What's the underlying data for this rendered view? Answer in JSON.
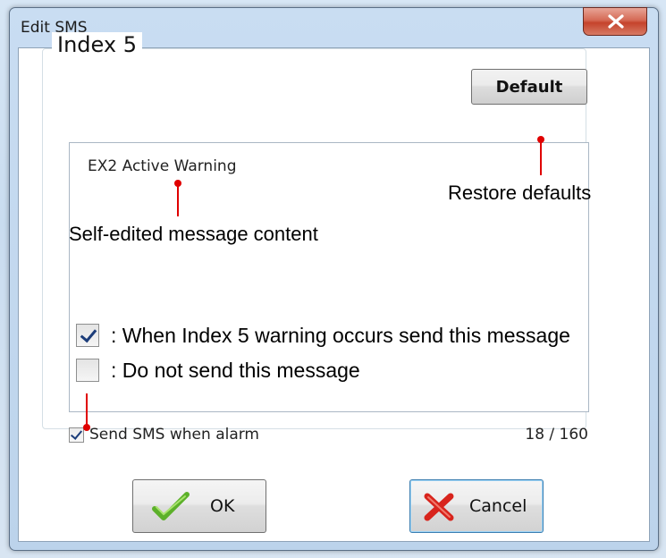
{
  "window": {
    "title": "Edit SMS",
    "close_icon": "close-x-icon"
  },
  "group": {
    "title": "Index 5"
  },
  "default_button": {
    "label": "Default"
  },
  "message": {
    "content": "EX2 Active Warning"
  },
  "send_sms": {
    "label": "Send SMS when alarm",
    "checked": true
  },
  "counter": "18 / 160",
  "legend": {
    "checked_text": ": When Index 5 warning occurs  send this message",
    "unchecked_text": ": Do not send this message"
  },
  "annotations": {
    "restore_defaults": "Restore defaults",
    "self_edited": "Self-edited message content"
  },
  "buttons": {
    "ok_label": "OK",
    "ok_icon": "green-check-icon",
    "cancel_label": "Cancel",
    "cancel_icon": "red-x-icon"
  },
  "colors": {
    "annotation_red": "#e00000",
    "checkbox_mark": "#1c3d7a"
  }
}
